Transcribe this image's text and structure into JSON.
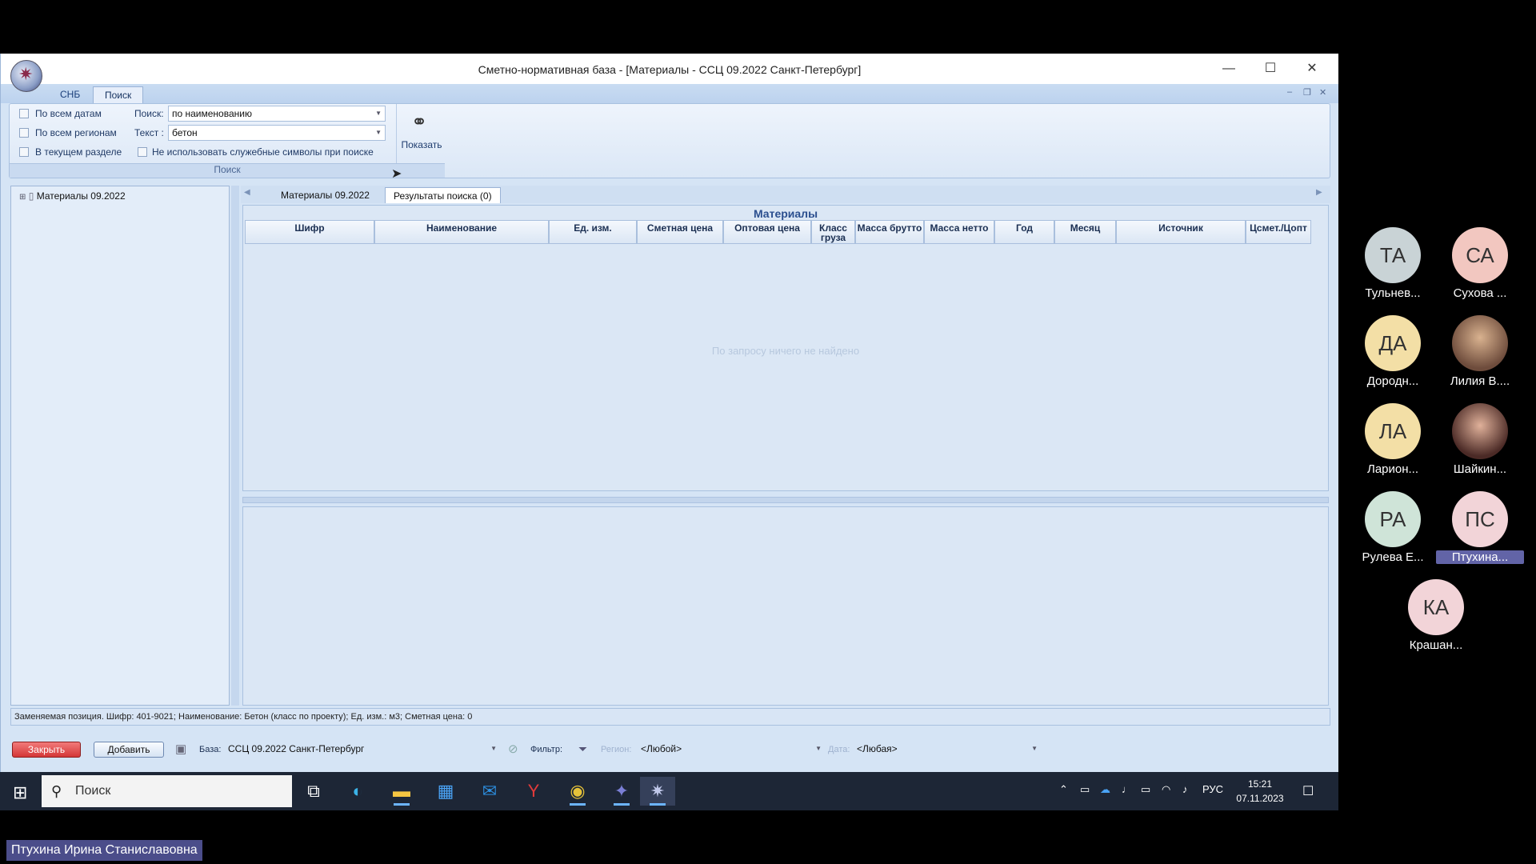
{
  "window": {
    "title": "Сметно-нормативная база - [Материалы - ССЦ 09.2022 Санкт-Петербург]",
    "minimize": "—",
    "maximize": "☐",
    "close": "✕"
  },
  "ribbon_tabs": [
    "СНБ",
    "Поиск"
  ],
  "ribbon": {
    "chk_all_dates": "По всем датам",
    "chk_all_regions": "По всем регионам",
    "chk_current_section": "В текущем разделе",
    "chk_no_special": "Не использовать служебные символы при поиске",
    "search_label": "Поиск:",
    "search_value": "по наименованию",
    "text_label": "Текст :",
    "text_value": "бетон",
    "show_button": "Показать",
    "group_caption": "Поиск"
  },
  "tree": {
    "root": "Материалы 09.2022"
  },
  "doc_tabs": [
    "Материалы 09.2022",
    "Результаты поиска (0)"
  ],
  "grid": {
    "title": "Материалы",
    "columns": [
      "Шифр",
      "Наименование",
      "Ед. изм.",
      "Сметная цена",
      "Оптовая цена",
      "Класс груза",
      "Масса брутто",
      "Масса нетто",
      "Год",
      "Месяц",
      "Источник",
      "Цсмет./Цопт"
    ],
    "empty_message": "По запросу ничего не найдено"
  },
  "status_text": "Заменяемая позиция. Шифр: 401-9021; Наименование: Бетон (класс по проекту); Ед. изм.: м3; Сметная цена: 0",
  "bottom": {
    "close_button": "Закрыть",
    "add_button": "Добавить",
    "base_label": "База:",
    "base_value": "ССЦ 09.2022 Санкт-Петербург",
    "filter_label": "Фильтр:",
    "region_label": "Регион:",
    "region_value": "<Любой>",
    "date_label": "Дата:",
    "date_value": "<Любая>"
  },
  "taskbar": {
    "search_placeholder": "Поиск",
    "lang": "РУС",
    "time": "15:21",
    "date": "07.11.2023"
  },
  "participants": [
    {
      "initials": "ТА",
      "name": "Тульнев...",
      "color": "#c9d3d6"
    },
    {
      "initials": "СА",
      "name": "Сухова ...",
      "color": "#f2c7c0"
    },
    {
      "initials": "ДА",
      "name": "Дородн...",
      "color": "#f3dfa6"
    },
    {
      "initials": "",
      "name": "Лилия В....",
      "color": "#7a5a4a"
    },
    {
      "initials": "ЛА",
      "name": "Ларион...",
      "color": "#f3dfa6"
    },
    {
      "initials": "",
      "name": "Шайкин...",
      "color": "#5a3a34"
    },
    {
      "initials": "РА",
      "name": "Рулева Е...",
      "color": "#cfe4d8"
    },
    {
      "initials": "ПС",
      "name": "Птухина...",
      "color": "#f2d4d8"
    },
    {
      "initials": "КА",
      "name": "Крашан...",
      "color": "#f2d4d8"
    }
  ],
  "presenter": "Птухина Ирина Станиславовна"
}
